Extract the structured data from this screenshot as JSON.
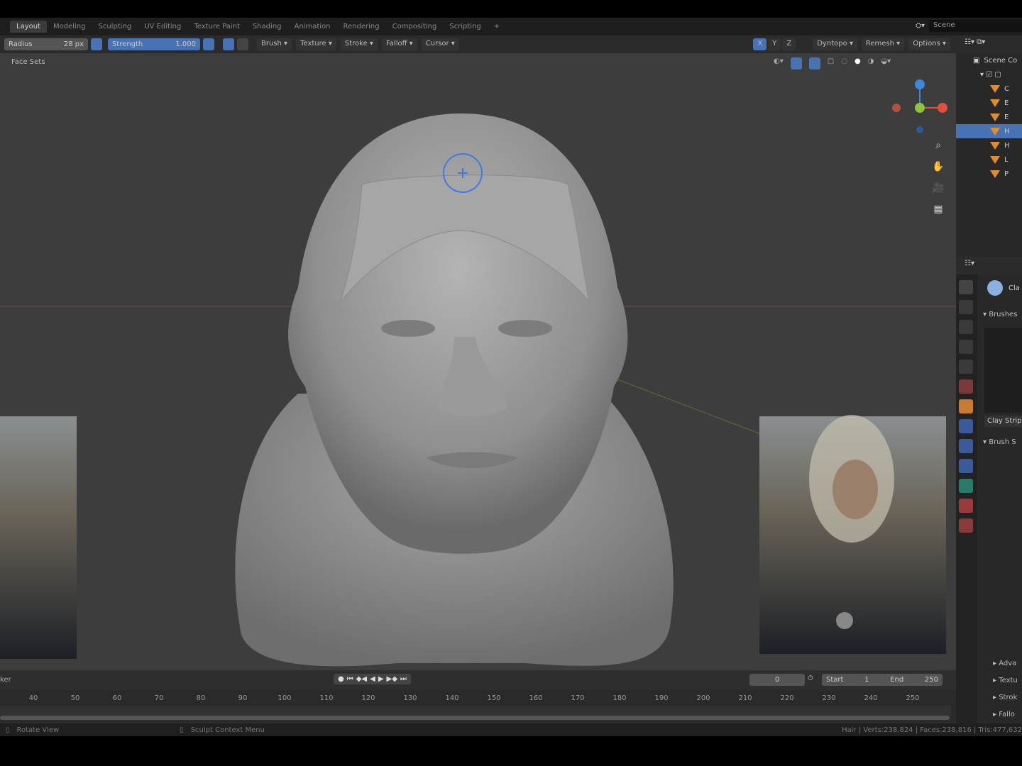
{
  "workspace_tabs": [
    "Layout",
    "Modeling",
    "Sculpting",
    "UV Editing",
    "Texture Paint",
    "Shading",
    "Animation",
    "Rendering",
    "Compositing",
    "Scripting"
  ],
  "active_tab": "Layout",
  "add_tab": "+",
  "scene_name": "Scene",
  "tool_header": {
    "radius_label": "Radius",
    "radius_value": "28 px",
    "strength_label": "Strength",
    "strength_value": "1.000",
    "menus": [
      "Brush",
      "Texture",
      "Stroke",
      "Falloff",
      "Cursor"
    ],
    "symmetry": [
      "X",
      "Y",
      "Z"
    ],
    "right_menus": [
      "Dyntopo",
      "Remesh",
      "Options"
    ]
  },
  "viewport": {
    "face_sets": "Face Sets"
  },
  "outliner": {
    "root": "Scene Co",
    "items": [
      "C",
      "E",
      "E",
      "H",
      "H",
      "L",
      "P"
    ],
    "selected_index": 3
  },
  "properties": {
    "brush_name": "Cla",
    "brushes_panel": "Brushes",
    "brush_preview_label": "Clay Strip",
    "brush_settings": "Brush S",
    "subpanels": [
      "Adva",
      "Textu",
      "Strok",
      "Fallo"
    ]
  },
  "timeline": {
    "label": "ker",
    "current_frame": "0",
    "start_label": "Start",
    "start": "1",
    "end_label": "End",
    "end": "250",
    "ticks": [
      "40",
      "50",
      "60",
      "70",
      "80",
      "90",
      "100",
      "110",
      "120",
      "130",
      "140",
      "150",
      "160",
      "170",
      "180",
      "190",
      "200",
      "210",
      "220",
      "230",
      "240",
      "250"
    ]
  },
  "status": {
    "left": "Rotate View",
    "middle": "Sculpt Context Menu",
    "right": "Hair | Verts:238,824 | Faces:238,816 | Tris:477,632"
  },
  "colors": {
    "accent": "#4772b3",
    "object": "#e08b2c",
    "gizmo_x": "#e0503c",
    "gizmo_y": "#8cc43c",
    "gizmo_z": "#3c88e0"
  }
}
